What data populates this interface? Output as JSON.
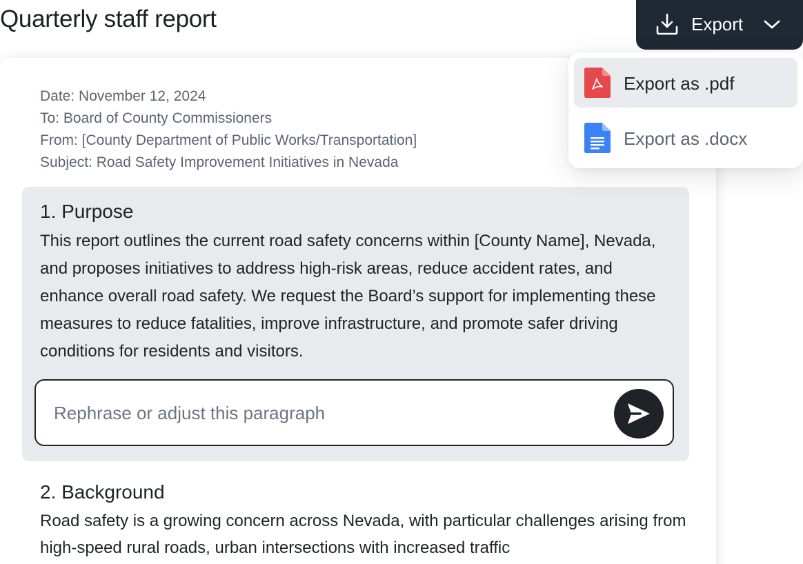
{
  "page": {
    "title": "Quarterly staff report"
  },
  "toolbar": {
    "export_label": "Export"
  },
  "export_menu": {
    "items": [
      {
        "label": "Export as .pdf",
        "icon": "pdf-file-icon",
        "color": "#e5484d"
      },
      {
        "label": "Export as .docx",
        "icon": "docx-file-icon",
        "color": "#3b82f6"
      }
    ]
  },
  "document": {
    "meta": {
      "date": "Date: November 12, 2024",
      "to": "To: Board of County Commissioners",
      "from": "From: [County Department of Public Works/Transportation]",
      "subject": "Subject: Road Safety Improvement Initiatives in Nevada"
    },
    "sections": [
      {
        "heading": "1. Purpose",
        "body": "This report outlines the current road safety concerns within [County Name], Nevada, and proposes initiatives to address high-risk areas, reduce accident rates, and enhance overall road safety. We request the Board’s support for implementing these measures to reduce fatalities, improve infrastructure, and promote safer driving conditions for residents and visitors."
      },
      {
        "heading": "2. Background",
        "body": "Road safety is a growing concern across Nevada, with particular challenges arising from high-speed rural roads, urban intersections with increased traffic"
      }
    ]
  },
  "rephrase": {
    "placeholder": "Rephrase or adjust this paragraph",
    "value": ""
  },
  "colors": {
    "dark": "#1f2933",
    "active_section_bg": "#e8eaed",
    "pdf": "#e5484d",
    "docx": "#3b82f6"
  }
}
